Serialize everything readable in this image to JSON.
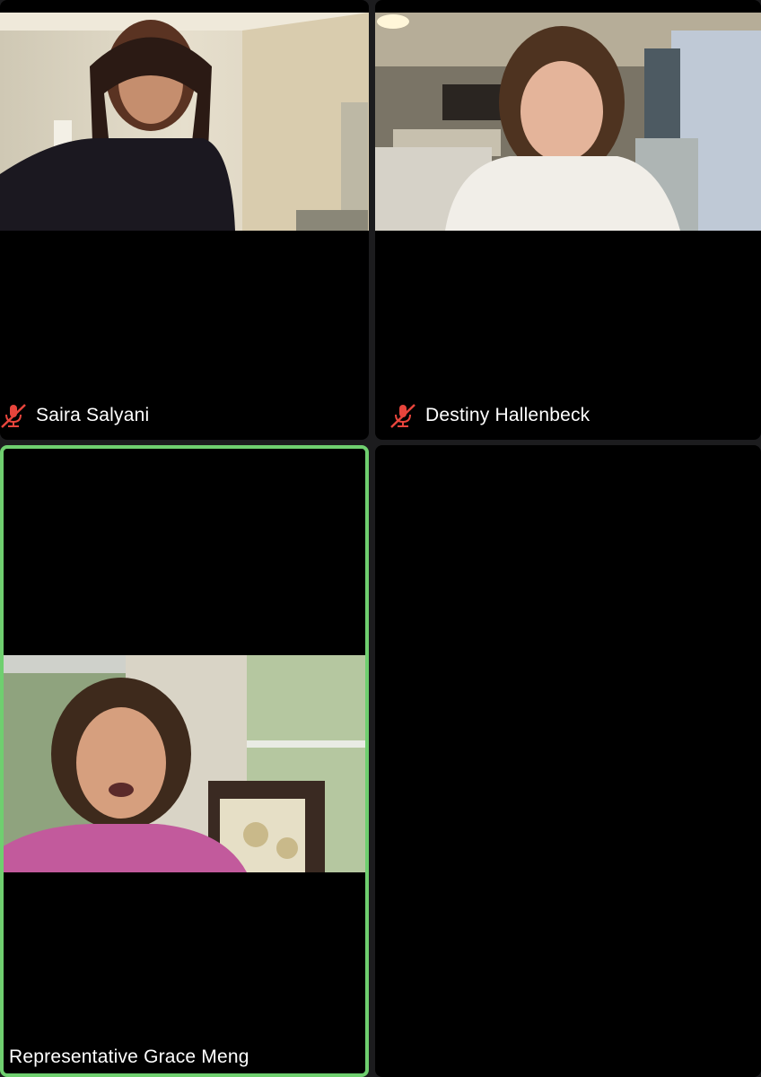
{
  "meeting": {
    "participants": [
      {
        "name": "Saira Salyani",
        "muted": true,
        "active_speaker": false,
        "icon": "mic-muted-icon"
      },
      {
        "name": "Destiny Hallenbeck",
        "muted": true,
        "active_speaker": false,
        "icon": "mic-muted-icon"
      },
      {
        "name": "Representative Grace Meng",
        "muted": false,
        "active_speaker": true
      },
      {
        "name": "",
        "empty": true
      }
    ]
  },
  "colors": {
    "background": "#1c1c1e",
    "tile": "#000000",
    "active_speaker_border": "#6fcf6f",
    "muted_icon": "#e8453c",
    "name_text": "#ffffff"
  }
}
